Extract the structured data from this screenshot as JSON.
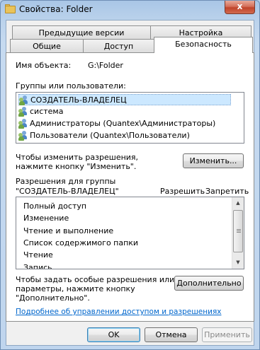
{
  "window": {
    "title": "Свойства: Folder",
    "close_glyph": "x"
  },
  "tabs": {
    "row1": [
      "Предыдущие версии",
      "Настройка"
    ],
    "row2": [
      "Общие",
      "Доступ",
      "Безопасность"
    ],
    "active": "Безопасность"
  },
  "security": {
    "object_label": "Имя объекта:",
    "object_value": "G:\\Folder",
    "groups_label": "Группы или пользователи:",
    "groups": [
      {
        "name": "СОЗДАТЕЛЬ-ВЛАДЕЛЕЦ",
        "icon": "users-icon",
        "selected": true
      },
      {
        "name": "система",
        "icon": "users-icon",
        "selected": false
      },
      {
        "name": "Администраторы (Quantex\\Администраторы)",
        "icon": "users-icon",
        "selected": false
      },
      {
        "name": "Пользователи (Quantex\\Пользователи)",
        "icon": "users-icon",
        "selected": false
      }
    ],
    "change_hint_line1": "Чтобы изменить разрешения,",
    "change_hint_line2": "нажмите кнопку \"Изменить\".",
    "change_button": "Изменить...",
    "permissions_for_line1": "Разрешения для группы",
    "permissions_for_line2": "\"СОЗДАТЕЛЬ-ВЛАДЕЛЕЦ\"",
    "allow_header": "Разрешить",
    "deny_header": "Запретить",
    "permissions": [
      "Полный доступ",
      "Изменение",
      "Чтение и выполнение",
      "Список содержимого папки",
      "Чтение",
      "Запись"
    ],
    "special_hint_line1": "Чтобы задать особые разрешения или",
    "special_hint_line2": "параметры, нажмите кнопку",
    "special_hint_line3": "\"Дополнительно\".",
    "advanced_button": "Дополнительно",
    "learn_more_link": "Подробнее об управлении доступом и разрешениях"
  },
  "footer": {
    "ok": "OK",
    "cancel": "Отмена",
    "apply": "Применить"
  },
  "colors": {
    "selection": "#cce8ff",
    "link": "#0066cc"
  }
}
